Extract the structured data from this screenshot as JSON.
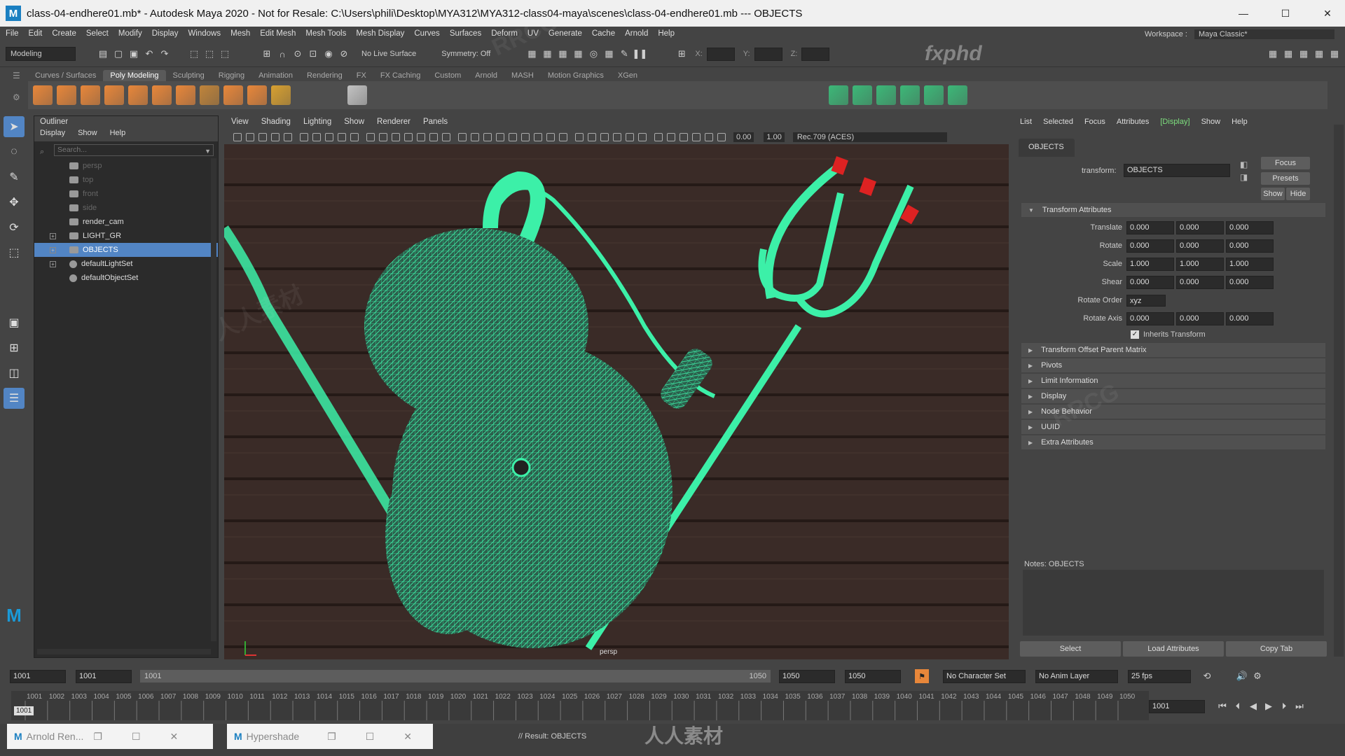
{
  "title_bar": {
    "title": "class-04-endhere01.mb* - Autodesk Maya 2020 - Not for Resale: C:\\Users\\phili\\Desktop\\MYA312\\MYA312-class04-maya\\scenes\\class-04-endhere01.mb  ---  OBJECTS",
    "minimize": "—",
    "maximize": "☐",
    "close": "✕"
  },
  "menu": [
    "File",
    "Edit",
    "Create",
    "Select",
    "Modify",
    "Display",
    "Windows",
    "Mesh",
    "Edit Mesh",
    "Mesh Tools",
    "Mesh Display",
    "Curves",
    "Surfaces",
    "Deform",
    "UV",
    "Generate",
    "Cache",
    "Arnold",
    "Help"
  ],
  "workspace": {
    "label": "Workspace :",
    "value": "Maya Classic*"
  },
  "status_line": {
    "menu_set": "Modeling",
    "live_surface": "No Live Surface",
    "symmetry": "Symmetry: Off",
    "x_label": "X:",
    "y_label": "Y:",
    "z_label": "Z:"
  },
  "shelf_tabs": [
    "Curves / Surfaces",
    "Poly Modeling",
    "Sculpting",
    "Rigging",
    "Animation",
    "Rendering",
    "FX",
    "FX Caching",
    "Custom",
    "Arnold",
    "MASH",
    "Motion Graphics",
    "XGen"
  ],
  "shelf_active": "Poly Modeling",
  "outliner": {
    "title": "Outliner",
    "menu": [
      "Display",
      "Show",
      "Help"
    ],
    "search_placeholder": "Search...",
    "items": [
      {
        "label": "persp",
        "dim": true
      },
      {
        "label": "top",
        "dim": true
      },
      {
        "label": "front",
        "dim": true
      },
      {
        "label": "side",
        "dim": true
      },
      {
        "label": "render_cam",
        "dim": false
      },
      {
        "label": "LIGHT_GR",
        "dim": false
      },
      {
        "label": "OBJECTS",
        "dim": false,
        "selected": true
      },
      {
        "label": "defaultLightSet",
        "dim": false
      },
      {
        "label": "defaultObjectSet",
        "dim": false
      }
    ]
  },
  "viewport": {
    "menu": [
      "View",
      "Shading",
      "Lighting",
      "Show",
      "Renderer",
      "Panels"
    ],
    "exposure": "0.00",
    "gamma": "1.00",
    "color_space": "Rec.709 (ACES)",
    "camera_label": "persp",
    "mesh_color": "#38e6a3"
  },
  "channel_box_menu": [
    "List",
    "Selected",
    "Focus",
    "Attributes",
    "[Display]",
    "Show",
    "Help"
  ],
  "attribute_editor": {
    "tab": "OBJECTS",
    "transform_label": "transform:",
    "transform_value": "OBJECTS",
    "buttons": {
      "focus": "Focus",
      "presets": "Presets",
      "show": "Show",
      "hide": "Hide"
    },
    "transform_section": "Transform Attributes",
    "translate": {
      "label": "Translate",
      "values": [
        "0.000",
        "0.000",
        "0.000"
      ]
    },
    "rotate": {
      "label": "Rotate",
      "values": [
        "0.000",
        "0.000",
        "0.000"
      ]
    },
    "scale": {
      "label": "Scale",
      "values": [
        "1.000",
        "1.000",
        "1.000"
      ]
    },
    "shear": {
      "label": "Shear",
      "values": [
        "0.000",
        "0.000",
        "0.000"
      ]
    },
    "rotate_order": {
      "label": "Rotate Order",
      "value": "xyz"
    },
    "rotate_axis": {
      "label": "Rotate Axis",
      "values": [
        "0.000",
        "0.000",
        "0.000"
      ]
    },
    "inherits_transform": "Inherits Transform",
    "sections": [
      "Transform Offset Parent Matrix",
      "Pivots",
      "Limit Information",
      "Display",
      "Node Behavior",
      "UUID",
      "Extra Attributes"
    ],
    "notes_label": "Notes: OBJECTS",
    "bottom_buttons": [
      "Select",
      "Load Attributes",
      "Copy Tab"
    ]
  },
  "time_range": {
    "start": "1001",
    "playback_start": "1001",
    "range_start": "1001",
    "range_end": "1050",
    "playback_end": "1050",
    "end": "1050",
    "character_set": "No Character Set",
    "anim_layer": "No Anim Layer",
    "fps": "25 fps",
    "current_frame": "1001"
  },
  "timeline": {
    "ticks": [
      "1001",
      "1002",
      "1003",
      "1004",
      "1005",
      "1006",
      "1007",
      "1008",
      "1009",
      "1010",
      "1011",
      "1012",
      "1013",
      "1014",
      "1015",
      "1016",
      "1017",
      "1018",
      "1019",
      "1020",
      "1021",
      "1022",
      "1023",
      "1024",
      "1025",
      "1026",
      "1027",
      "1028",
      "1029",
      "1030",
      "1031",
      "1032",
      "1033",
      "1034",
      "1035",
      "1036",
      "1037",
      "1038",
      "1039",
      "1040",
      "1041",
      "1042",
      "1043",
      "1044",
      "1045",
      "1046",
      "1047",
      "1048",
      "1049",
      "1050"
    ],
    "current": "1001"
  },
  "taskbar": {
    "item1": "Arnold Ren...",
    "item2": "Hypershade",
    "result": "// Result: OBJECTS"
  },
  "watermarks": [
    "RRCG",
    "人人素材",
    "fxphd"
  ]
}
